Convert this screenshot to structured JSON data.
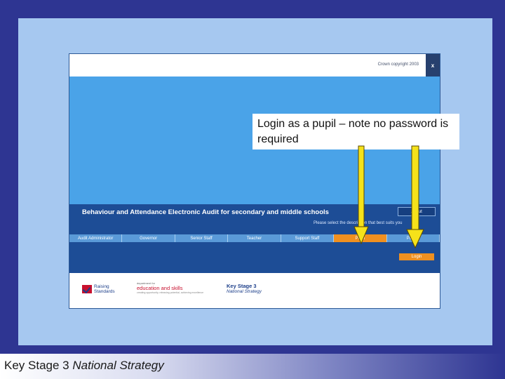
{
  "app": {
    "copyright": "Crown copyright 2003",
    "close_label": "x",
    "title": "Behaviour and Attendance Electronic Audit for secondary and middle schools",
    "about_label": "About",
    "instruction": "Please select the description that best suits you",
    "tabs": [
      {
        "label": "Audit Administrator"
      },
      {
        "label": "Governor"
      },
      {
        "label": "Senior Staff"
      },
      {
        "label": "Teacher"
      },
      {
        "label": "Support Staff"
      },
      {
        "label": "Pupil"
      },
      {
        "label": "Parent"
      }
    ],
    "active_tab": "Pupil",
    "login_label": "Login"
  },
  "logos": {
    "raising_standards": "Raising Standards",
    "des_small": "department for",
    "des_name": "education and skills",
    "des_tag": "creating opportunity, releasing potential, achieving excellence",
    "ks3_title": "Key Stage 3",
    "ks3_sub": "National Strategy"
  },
  "callout": {
    "text": "Login as a pupil – note no password is required"
  },
  "footer": {
    "prefix": "Key Stage 3",
    "italic": "National Strategy"
  },
  "colors": {
    "slide_border": "#2e3592",
    "slide_bg": "#a6c8f0",
    "app_dark": "#1d4d96",
    "app_light": "#4aa3e8",
    "accent_orange": "#f09020",
    "arrow_yellow": "#f5e21a"
  }
}
